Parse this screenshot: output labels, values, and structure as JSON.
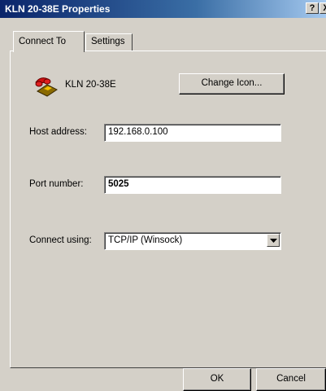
{
  "window": {
    "title": "KLN 20-38E Properties",
    "help_glyph": "?",
    "close_glyph": "X"
  },
  "tabs": [
    {
      "label": "Connect To",
      "active": true
    },
    {
      "label": "Settings",
      "active": false
    }
  ],
  "connection": {
    "icon": "telephone-icon",
    "name": "KLN 20-38E",
    "change_icon_label": "Change Icon..."
  },
  "host": {
    "label": "Host address:",
    "value": "192.168.0.100"
  },
  "port": {
    "label": "Port number:",
    "value": "5025"
  },
  "connect_using": {
    "label": "Connect using:",
    "value": "TCP/IP (Winsock)"
  },
  "buttons": {
    "ok": "OK",
    "cancel": "Cancel"
  },
  "colors": {
    "titlebar": "#0a246a",
    "face": "#d4d0c8"
  }
}
